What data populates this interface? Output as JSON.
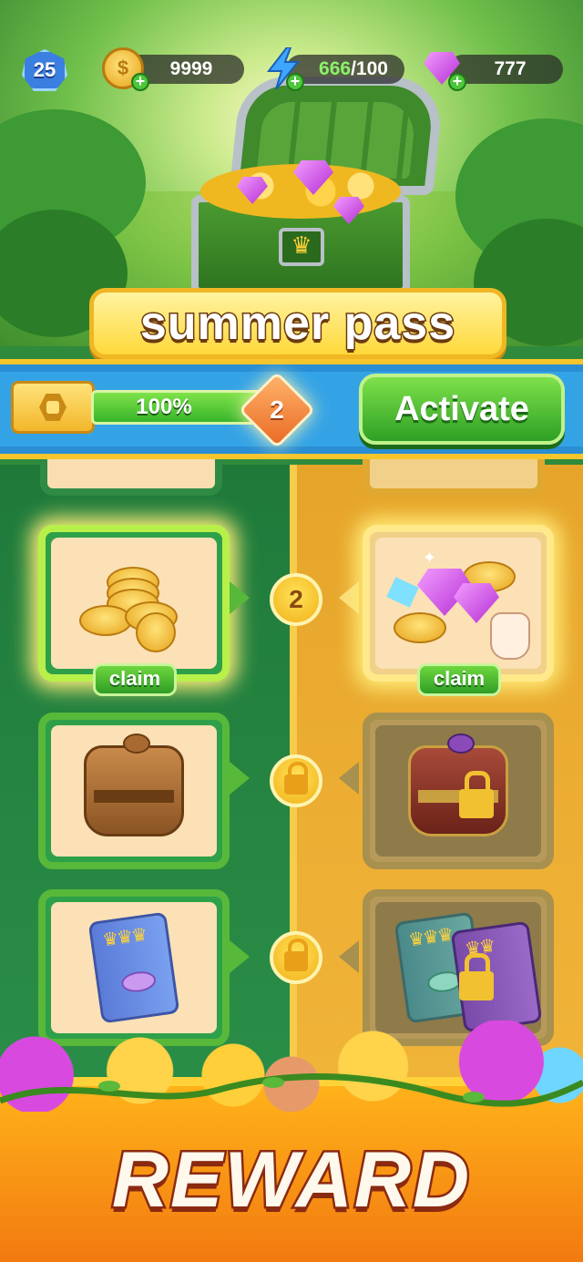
{
  "hud": {
    "level": "25",
    "coins": "9999",
    "energy_current": "666",
    "energy_max": "/100",
    "gems": "777",
    "icons": [
      "level-star-icon",
      "coin-icon",
      "lightning-icon",
      "gem-icon",
      "plus-icon"
    ]
  },
  "title": "summer pass",
  "progress": {
    "percent_label": "100%",
    "percent_value": 100,
    "next_level": "2",
    "activate_label": "Activate"
  },
  "tracks": {
    "free": [
      {
        "reward": "coins",
        "state": "claimable",
        "claim_label": "claim"
      },
      {
        "reward": "treasure pouch",
        "state": "locked"
      },
      {
        "reward": "card pack",
        "state": "locked"
      }
    ],
    "premium": [
      {
        "reward": "gems and coins",
        "state": "claimable",
        "claim_label": "claim"
      },
      {
        "reward": "premium treasure pouch",
        "state": "locked"
      },
      {
        "reward": "premium card packs",
        "state": "locked"
      }
    ],
    "nodes": [
      "2",
      "lock",
      "lock"
    ]
  },
  "colors": {
    "free_track": "#2b8f48",
    "premium_track": "#f1b53a",
    "accent_green": "#2ea025",
    "gold": "#ffd23a",
    "strip_blue": "#34a3e6"
  },
  "footer": {
    "banner": "REWARD"
  }
}
